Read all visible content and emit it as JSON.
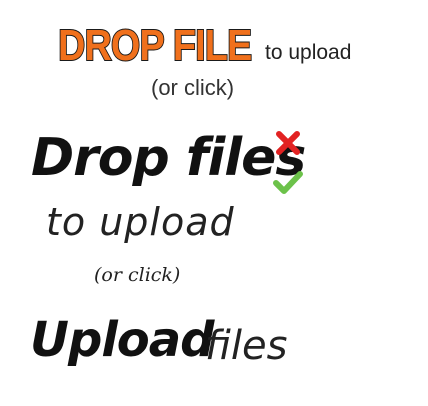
{
  "top": {
    "logo_text": "DROP FILE",
    "to_upload": "to upload",
    "or_click": "(or click)"
  },
  "middle": {
    "heading": "Drop files",
    "to_upload": "to upload",
    "or_click": "(or click)"
  },
  "bottom": {
    "heading": "Upload",
    "files": "files"
  },
  "icons": {
    "reject": "close-x-icon",
    "accept": "checkmark-icon"
  },
  "colors": {
    "logo_fill": "#f0701c",
    "logo_outline": "#1a1a1a",
    "reject": "#e22222",
    "accept": "#6cc24a",
    "text": "#111111"
  }
}
